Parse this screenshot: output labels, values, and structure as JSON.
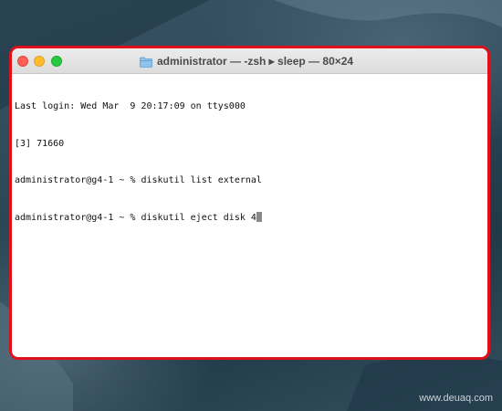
{
  "window": {
    "title": "administrator — -zsh ▸ sleep — 80×24",
    "title_icon": "folder-icon",
    "controls": [
      "close",
      "minimize",
      "zoom"
    ],
    "highlight_color": "#e0101a"
  },
  "terminal": {
    "lines": [
      "Last login: Wed Mar  9 20:17:09 on ttys000",
      "[3] 71660",
      "administrator@g4-1 ~ % diskutil list external",
      "administrator@g4-1 ~ % diskutil eject disk 4"
    ]
  },
  "watermark": "www.deuaq.com"
}
